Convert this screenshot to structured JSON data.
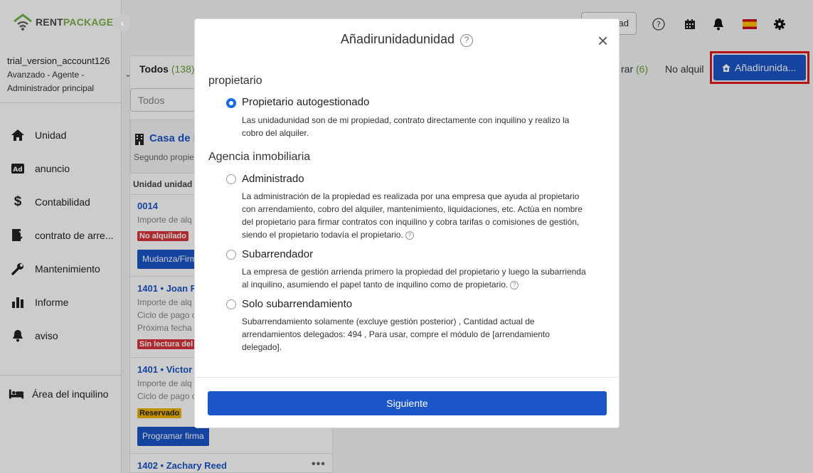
{
  "brand": {
    "rent": "RENT",
    "package": "PACKAGE"
  },
  "account": {
    "name": "trial_version_account126",
    "role": "Avanzado - Agente - Administrador principal"
  },
  "sidebar": {
    "items": [
      {
        "label": "Unidad",
        "icon": "home-icon"
      },
      {
        "label": "anuncio",
        "icon": "ad-icon"
      },
      {
        "label": "Contabilidad",
        "icon": "dollar-icon"
      },
      {
        "label": "contrato de arre...",
        "icon": "contract-icon"
      },
      {
        "label": "Mantenimiento",
        "icon": "wrench-icon"
      },
      {
        "label": "Informe",
        "icon": "bar-chart-icon"
      },
      {
        "label": "aviso",
        "icon": "bell-icon"
      }
    ],
    "tenant_area": "Área del inquilino"
  },
  "topbar": {
    "button_label": "ad"
  },
  "list": {
    "tab_all": "Todos",
    "tab_all_count": "(138)",
    "filter_value": "Todos",
    "group_title": "Casa de l",
    "group_sub": "Segundo propie",
    "column_header": "Unidad unidad",
    "units": [
      {
        "code": "0014",
        "lines": [
          "Importe de alq"
        ],
        "badge": "No alquilado",
        "button": "Mudanza/Firm"
      },
      {
        "code": "1401 • Joan R",
        "lines": [
          "Importe de alq",
          "Ciclo de pago c",
          "Próxima fecha"
        ],
        "badge": "Sin lectura del m"
      },
      {
        "code": "1401 • Victor",
        "lines": [
          "Importe de alq",
          "Ciclo de pago c"
        ],
        "badge": "Reservado",
        "button": "Programar firma"
      },
      {
        "code": "1402 • Zachary Reed"
      }
    ],
    "more": "•••"
  },
  "right_tabs": [
    {
      "label": "rar",
      "count": "(6)"
    },
    {
      "label": "No alquil",
      "count": ""
    }
  ],
  "add_button": "Añadirunida...",
  "modal": {
    "title": "Añadirunidadunidad",
    "help": "?",
    "close": "×",
    "section_owner": "propietario",
    "section_agency": "Agencia inmobiliaria",
    "options": [
      {
        "title": "Propietario autogestionado",
        "desc": "Las unidadunidad son de mi propiedad, contrato directamente con inquilino y realizo la cobro del alquiler.",
        "checked": true
      },
      {
        "title": "Administrado",
        "desc": "La administración de la propiedad es realizada por una empresa que ayuda al propietario con arrendamiento, cobro del alquiler, mantenimiento, liquidaciones, etc. Actúa en nombre del propietario para firmar contratos con inquilino y cobra tarifas o comisiones de gestión, siendo el propietario todavía el propietario.",
        "checked": false
      },
      {
        "title": "Subarrendador",
        "desc": "La empresa de gestión arrienda primero la propiedad del propietario y luego la subarrienda al inquilino, asumiendo el papel tanto de inquilino como de propietario.",
        "checked": false
      },
      {
        "title": "Solo subarrendamiento",
        "desc": "Subarrendamiento solamente (excluye gestión posterior) , Cantidad actual de arrendamientos delegados: 494 , Para usar, compre el módulo de [arrendamiento delegado].",
        "checked": false
      }
    ],
    "next": "Siguiente"
  },
  "colors": {
    "primary": "#1a56c8",
    "brand_green": "#7ab24a",
    "badge_red": "#d9363e",
    "badge_yellow": "#f0b400",
    "highlight_red": "#e21a1a"
  }
}
